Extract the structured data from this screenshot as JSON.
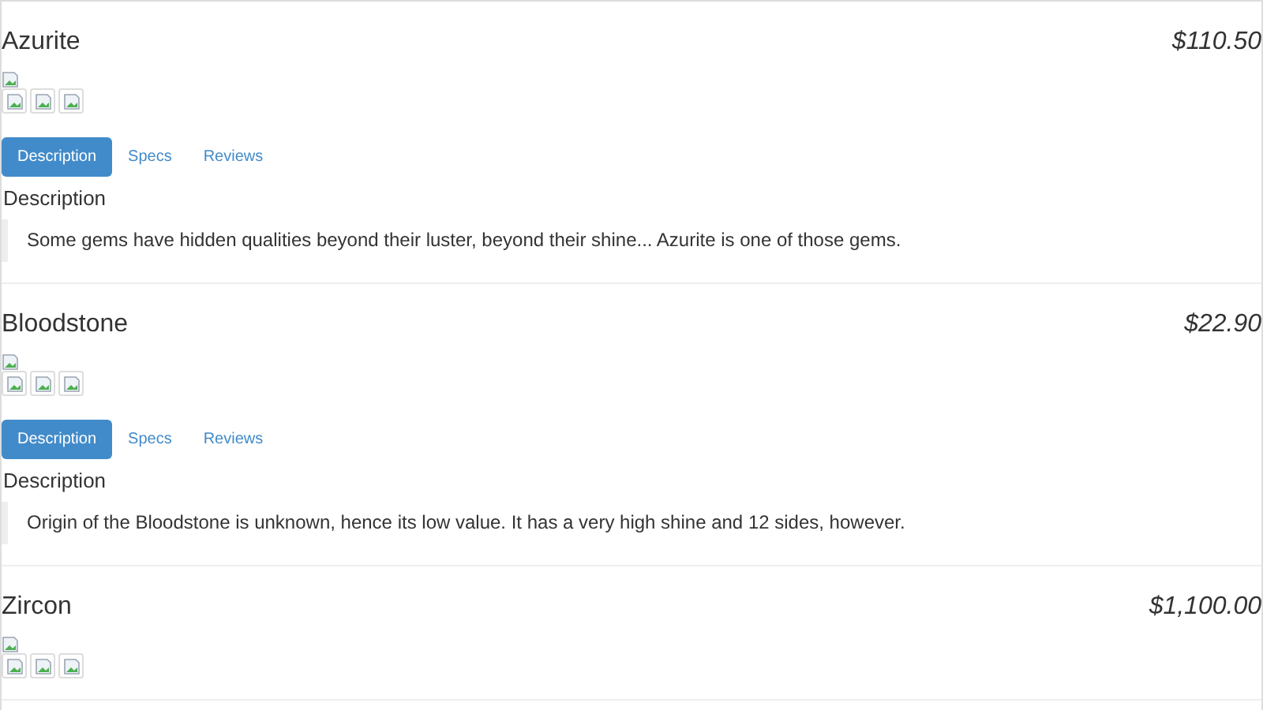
{
  "products": [
    {
      "name": "Azurite",
      "price": "$110.50",
      "tabs": [
        {
          "label": "Description",
          "selected": true
        },
        {
          "label": "Specs",
          "selected": false
        },
        {
          "label": "Reviews",
          "selected": false
        }
      ],
      "section_heading": "Description",
      "description": "Some gems have hidden qualities beyond their luster, beyond their shine... Azurite is one of those gems."
    },
    {
      "name": "Bloodstone",
      "price": "$22.90",
      "tabs": [
        {
          "label": "Description",
          "selected": true
        },
        {
          "label": "Specs",
          "selected": false
        },
        {
          "label": "Reviews",
          "selected": false
        }
      ],
      "section_heading": "Description",
      "description": "Origin of the Bloodstone is unknown, hence its low value. It has a very high shine and 12 sides, however."
    },
    {
      "name": "Zircon",
      "price": "$1,100.00"
    }
  ]
}
